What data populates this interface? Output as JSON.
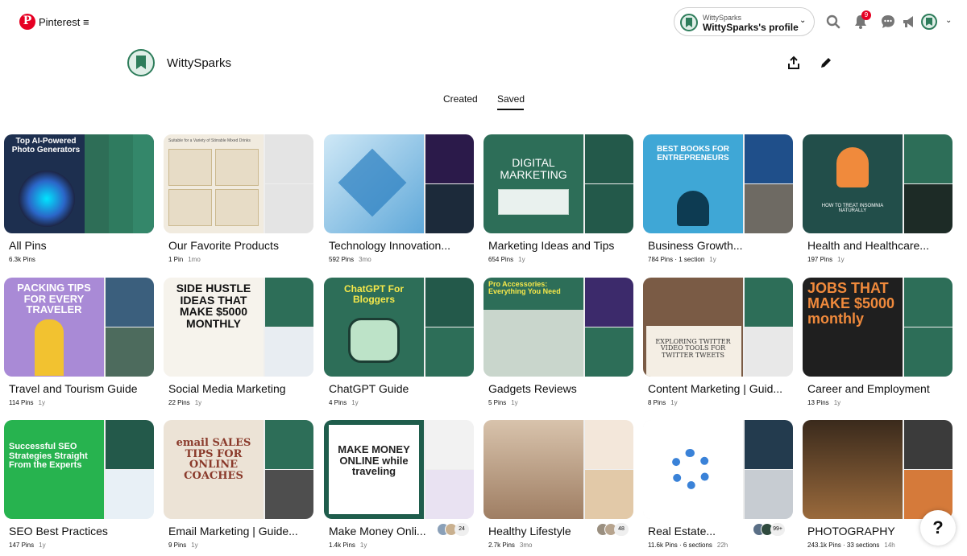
{
  "app": {
    "brand": "Pinterest"
  },
  "header": {
    "account_sub": "WittySparks",
    "account_name": "WittySparks's profile",
    "notification_count": "9"
  },
  "profile": {
    "name": "WittySparks"
  },
  "tabs": [
    {
      "label": "Created"
    },
    {
      "label": "Saved"
    }
  ],
  "active_tab": "Saved",
  "boards": [
    {
      "title": "All Pins",
      "pins": "6.3k Pins",
      "age": "",
      "cover_text": "Top AI-Powered Photo Generators"
    },
    {
      "title": "Our Favorite Products",
      "pins": "1 Pin",
      "age": "1mo",
      "cover_text": "Suitable for a Variety of Stirrable Mixed Drinks"
    },
    {
      "title": "Technology Innovation...",
      "pins": "592 Pins",
      "age": "3mo",
      "cover_text": ""
    },
    {
      "title": "Marketing Ideas and Tips",
      "pins": "654 Pins",
      "age": "1y",
      "cover_text": "DIGITAL MARKETING"
    },
    {
      "title": "Business Growth...",
      "pins": "784 Pins · 1 section",
      "age": "1y",
      "cover_text": "BEST BOOKS FOR ENTREPRENEURS"
    },
    {
      "title": "Health and Healthcare...",
      "pins": "197 Pins",
      "age": "1y",
      "cover_text": "HOW TO TREAT INSOMNIA NATURALLY"
    },
    {
      "title": "Travel and Tourism Guide",
      "pins": "114 Pins",
      "age": "1y",
      "cover_text": "PACKING TIPS FOR EVERY TRAVELER"
    },
    {
      "title": "Social Media Marketing",
      "pins": "22 Pins",
      "age": "1y",
      "cover_text": "SIDE HUSTLE IDEAS THAT MAKE $5000 MONTHLY"
    },
    {
      "title": "ChatGPT Guide",
      "pins": "4 Pins",
      "age": "1y",
      "cover_text": "ChatGPT For Bloggers"
    },
    {
      "title": "Gadgets Reviews",
      "pins": "5 Pins",
      "age": "1y",
      "cover_text": "Pro Accessories: Everything You Need"
    },
    {
      "title": "Content Marketing | Guid...",
      "pins": "8 Pins",
      "age": "1y",
      "cover_text": "EXPLORING TWITTER VIDEO TOOLS FOR TWITTER TWEETS"
    },
    {
      "title": "Career and Employment",
      "pins": "13 Pins",
      "age": "1y",
      "cover_text": "JOBS THAT MAKE $5000 monthly"
    },
    {
      "title": "SEO Best Practices",
      "pins": "147 Pins",
      "age": "1y",
      "cover_text": "Successful SEO Strategies Straight From the Experts"
    },
    {
      "title": "Email Marketing | Guide...",
      "pins": "9 Pins",
      "age": "1y",
      "cover_text": "email SALES TIPS FOR ONLINE COACHES"
    },
    {
      "title": "Make Money Onli...",
      "pins": "1.4k Pins",
      "age": "1y",
      "cover_text": "MAKE MONEY ONLINE while traveling",
      "collab": "24"
    },
    {
      "title": "Healthy Lifestyle",
      "pins": "2.7k Pins",
      "age": "3mo",
      "cover_text": "",
      "collab": "48"
    },
    {
      "title": "Real Estate...",
      "pins": "11.6k Pins · 6 sections",
      "age": "22h",
      "cover_text": "",
      "collab": "99+"
    },
    {
      "title": "PHOTOGRAPHY",
      "pins": "243.1k Pins · 33 sections",
      "age": "14h",
      "cover_text": ""
    }
  ],
  "colors": {
    "brand": "#e60023",
    "accent": "#2e7d5b"
  },
  "help_label": "?"
}
